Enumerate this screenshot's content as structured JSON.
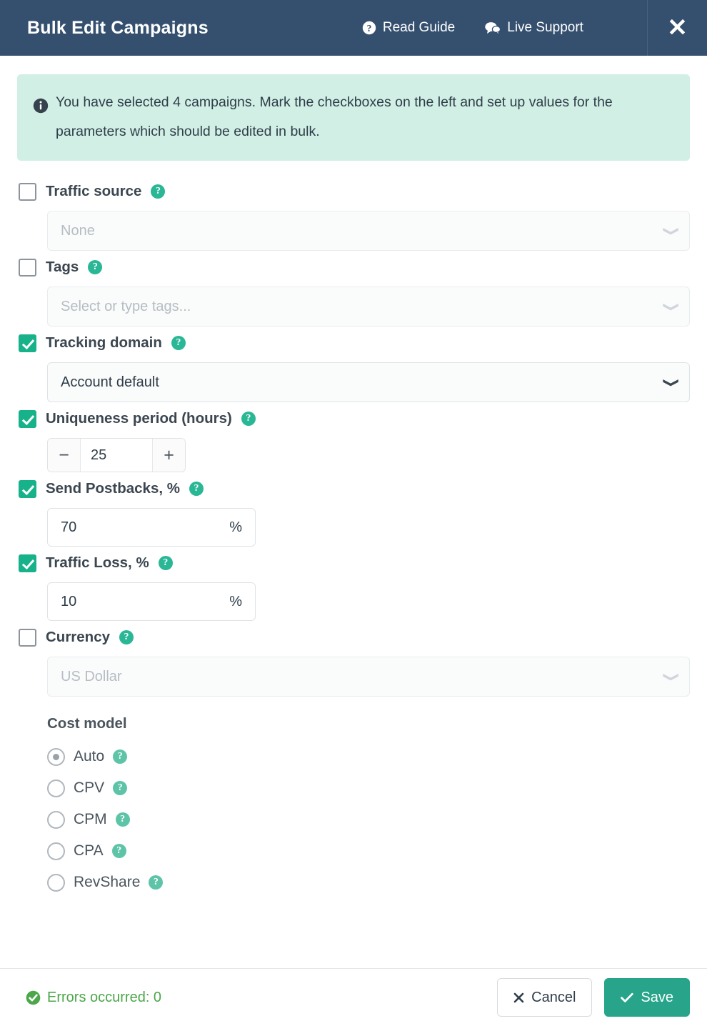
{
  "header": {
    "title": "Bulk Edit Campaigns",
    "links": [
      {
        "label": "Read Guide",
        "icon": "question-circle-icon"
      },
      {
        "label": "Live Support",
        "icon": "comments-icon"
      }
    ],
    "close_label": "✕",
    "background_color": "#35506f"
  },
  "alert": {
    "icon": "info-circle-icon",
    "text": "You have selected 4 campaigns. Mark the checkboxes on the left and set up values for the parameters which should be edited in bulk.",
    "background_color": "#d2efe5"
  },
  "fields": {
    "traffic_source": {
      "label": "Traffic source",
      "checked": false,
      "disabled": true,
      "value": "None",
      "help": "?"
    },
    "tags": {
      "label": "Tags",
      "checked": false,
      "disabled": true,
      "value": "Select or type tags...",
      "help": "?"
    },
    "tracking_domain": {
      "label": "Tracking domain",
      "checked": true,
      "disabled": false,
      "value": "Account default",
      "help": "?"
    },
    "uniqueness_period": {
      "label": "Uniqueness period (hours)",
      "checked": true,
      "value": "25",
      "minus": "−",
      "plus": "+",
      "help": "?"
    },
    "send_postbacks": {
      "label": "Send Postbacks, %",
      "checked": true,
      "value": "70",
      "unit": "%",
      "help": "?"
    },
    "traffic_loss": {
      "label": "Traffic Loss, %",
      "checked": true,
      "value": "10",
      "unit": "%",
      "help": "?"
    },
    "currency": {
      "label": "Currency",
      "checked": false,
      "disabled": true,
      "value": "US Dollar",
      "help": "?"
    }
  },
  "cost_model": {
    "title": "Cost model",
    "selected": "Auto",
    "options": [
      {
        "label": "Auto",
        "selected": true,
        "help": "?"
      },
      {
        "label": "CPV",
        "selected": false,
        "help": "?"
      },
      {
        "label": "CPM",
        "selected": false,
        "help": "?"
      },
      {
        "label": "CPA",
        "selected": false,
        "help": "?"
      },
      {
        "label": "RevShare",
        "selected": false,
        "help": "?"
      }
    ]
  },
  "footer": {
    "errors_text": "Errors occurred: 0",
    "errors_color": "#4ba749",
    "cancel_label": "Cancel",
    "save_label": "Save",
    "save_color": "#27a489"
  }
}
